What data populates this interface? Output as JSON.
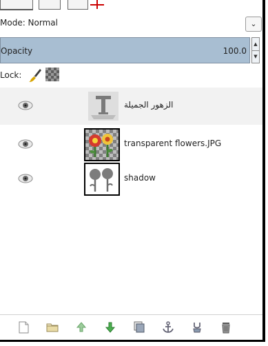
{
  "mode": {
    "label": "Mode: Normal",
    "dropdown_glyph": "⌄"
  },
  "opacity": {
    "label": "Opacity",
    "value": "100.0"
  },
  "lock": {
    "label": "Lock:",
    "icons": [
      "paintbrush-icon",
      "alpha-checker-icon"
    ]
  },
  "layers": [
    {
      "name": "الزهور الجميلة",
      "type": "text",
      "visible": true,
      "selected": true
    },
    {
      "name": "transparent flowers.JPG",
      "type": "image",
      "visible": true,
      "selected": false
    },
    {
      "name": "shadow",
      "type": "image",
      "visible": true,
      "selected": false
    }
  ],
  "bottom_toolbar": [
    "new-layer-icon",
    "new-group-icon",
    "raise-layer-icon",
    "lower-layer-icon",
    "duplicate-layer-icon",
    "anchor-layer-icon",
    "merge-layer-icon",
    "delete-layer-icon"
  ],
  "colors": {
    "opacity_bar": "#a8bed2",
    "raise_arrow": "#9ccc9c",
    "lower_arrow": "#4caf50",
    "selected_row": "#f2f2f2"
  }
}
